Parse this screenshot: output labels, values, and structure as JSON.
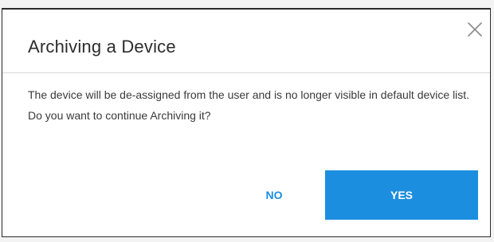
{
  "dialog": {
    "title": "Archiving a Device",
    "close_icon": "close-icon",
    "body_line_1": "The device will be de-assigned from the user and is no longer visible in default device list.",
    "body_line_2": "Do you want to continue Archiving it?",
    "no_label": "NO",
    "yes_label": "YES"
  },
  "colors": {
    "accent": "#1c8ee0",
    "no_text": "#1a8ee0",
    "title_text": "#2c2c2c",
    "body_text": "#3a3a3a"
  }
}
